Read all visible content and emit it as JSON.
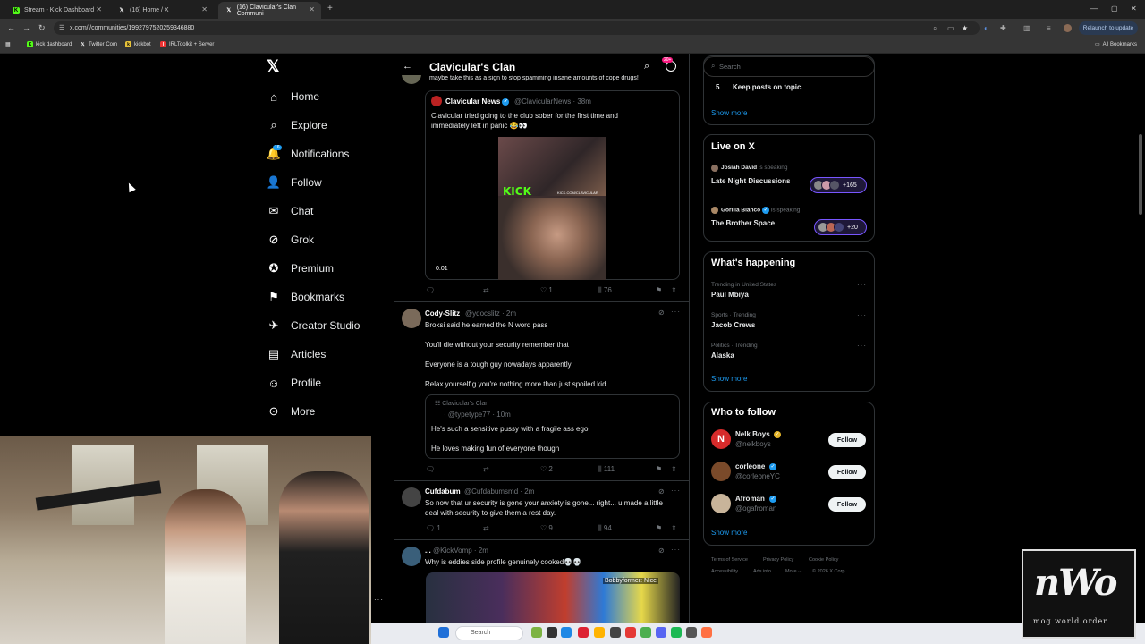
{
  "browser": {
    "tabs": [
      {
        "title": "Stream - Kick Dashboard",
        "favicon": "kick-icon",
        "color": "#53fc18"
      },
      {
        "title": "(16) Home / X",
        "favicon": "x-icon",
        "color": "#ffffff"
      },
      {
        "title": "(16) Clavicular's Clan Communi",
        "favicon": "x-icon",
        "color": "#ffffff"
      }
    ],
    "url": "x.com/i/communities/1992797520259346880",
    "relaunch_label": "Relaunch to update",
    "bookmarks": [
      {
        "label": "kick dashboard"
      },
      {
        "label": "Twitter Com"
      },
      {
        "label": "kickbot"
      },
      {
        "label": "IRLToolkit + Server"
      }
    ],
    "all_bookmarks_label": "All Bookmarks"
  },
  "sidebar": {
    "notifications_badge": "16",
    "items": [
      {
        "label": "Home",
        "icon": "home-icon",
        "glyph": "⌂"
      },
      {
        "label": "Explore",
        "icon": "search-icon",
        "glyph": "⌕"
      },
      {
        "label": "Notifications",
        "icon": "bell-icon",
        "glyph": "🔔"
      },
      {
        "label": "Follow",
        "icon": "add-person-icon",
        "glyph": "👤"
      },
      {
        "label": "Chat",
        "icon": "mail-icon",
        "glyph": "✉"
      },
      {
        "label": "Grok",
        "icon": "grok-icon",
        "glyph": "⊘"
      },
      {
        "label": "Premium",
        "icon": "premium-icon",
        "glyph": "✪"
      },
      {
        "label": "Bookmarks",
        "icon": "bookmark-icon",
        "glyph": "⚑"
      },
      {
        "label": "Creator Studio",
        "icon": "rocket-icon",
        "glyph": "✈"
      },
      {
        "label": "Articles",
        "icon": "article-icon",
        "glyph": "▤"
      },
      {
        "label": "Profile",
        "icon": "profile-icon",
        "glyph": "☺"
      },
      {
        "label": "More",
        "icon": "more-icon",
        "glyph": "⊙"
      }
    ]
  },
  "timeline": {
    "title": "Clavicular's Clan",
    "notif_count": "20+",
    "cut_text": "maybe take this as a sign to stop spamming insane amounts of cope drugs!",
    "quoted": {
      "name": "Clavicular News",
      "handle": "@ClavicularNews · 38m",
      "text1": "Clavicular tried going to the club sober for the first time and",
      "text2": "immediately left in panic 😂👀",
      "kick_label": "KICK",
      "kick_url": "KICK.COM/CLAVICULAR",
      "video_time": "0:01"
    },
    "actions1": {
      "likes": "1",
      "views": "76"
    },
    "post2": {
      "name": "Cody-Slitz",
      "handle": "@ydocslitz · 2m",
      "lines": [
        "Broksi said he earned the N word pass",
        "You'll die without your security remember that",
        "Everyone is a tough guy nowadays apparently",
        "Relax yourself g you're nothing more than just spoiled kid"
      ],
      "quote_community": "Clavicular's Clan",
      "quote_handle": "@typetype77 · 10m",
      "quote_line1": "He's such a sensitive pussy with a fragile ass ego",
      "quote_line2": "He loves making fun of everyone though",
      "likes": "2",
      "views": "111"
    },
    "post3": {
      "name": "Cufdabum",
      "handle": "@Cufdabumsmd · 2m",
      "line1": "So now that ur security is gone your anxiety is gone... right... u made a little",
      "line2": "deal with security to give them a rest day.",
      "replies": "1",
      "likes": "9",
      "views": "94"
    },
    "post4": {
      "name": "...",
      "handle": "@KickVomp · 2m",
      "text": "Why is eddies side profile genuinely cooked💀💀",
      "img_caption": "Bobbyformer: Nice"
    }
  },
  "right": {
    "search_placeholder": "Search",
    "rule_num": "5",
    "rule_text": "Keep posts on topic",
    "show_more": "Show more",
    "live_title": "Live on X",
    "spaces": [
      {
        "host": "Josiah David",
        "status": "is speaking",
        "title": "Late Night Discussions",
        "count": "+165"
      },
      {
        "host": "Gorilla Blanco",
        "status": "is speaking",
        "title": "The Brother Space",
        "count": "+20"
      }
    ],
    "happening_title": "What's happening",
    "trends": [
      {
        "meta": "Trending in United States",
        "name": "Paul Mbiya"
      },
      {
        "meta": "Sports · Trending",
        "name": "Jacob Crews"
      },
      {
        "meta": "Politics · Trending",
        "name": "Alaska"
      }
    ],
    "wtf_title": "Who to follow",
    "follow_label": "Follow",
    "suggestions": [
      {
        "name": "Nelk Boys",
        "handle": "@nelkboys",
        "avatar_color": "#d62b2b",
        "avatar_letter": "N"
      },
      {
        "name": "corleone",
        "handle": "@corleoneYC",
        "avatar_color": "#7a4a2a",
        "avatar_letter": ""
      },
      {
        "name": "Afroman",
        "handle": "@ogafroman",
        "avatar_color": "#c8b49a",
        "avatar_letter": ""
      }
    ],
    "footer": [
      "Terms of Service",
      "Privacy Policy",
      "Cookie Policy",
      "Accessibility",
      "Ads info",
      "More ···",
      "© 2026 X Corp."
    ]
  },
  "taskbar": {
    "search_placeholder": "Search"
  },
  "overlay_logo": {
    "big": "nWo",
    "sub": "mog world order"
  }
}
